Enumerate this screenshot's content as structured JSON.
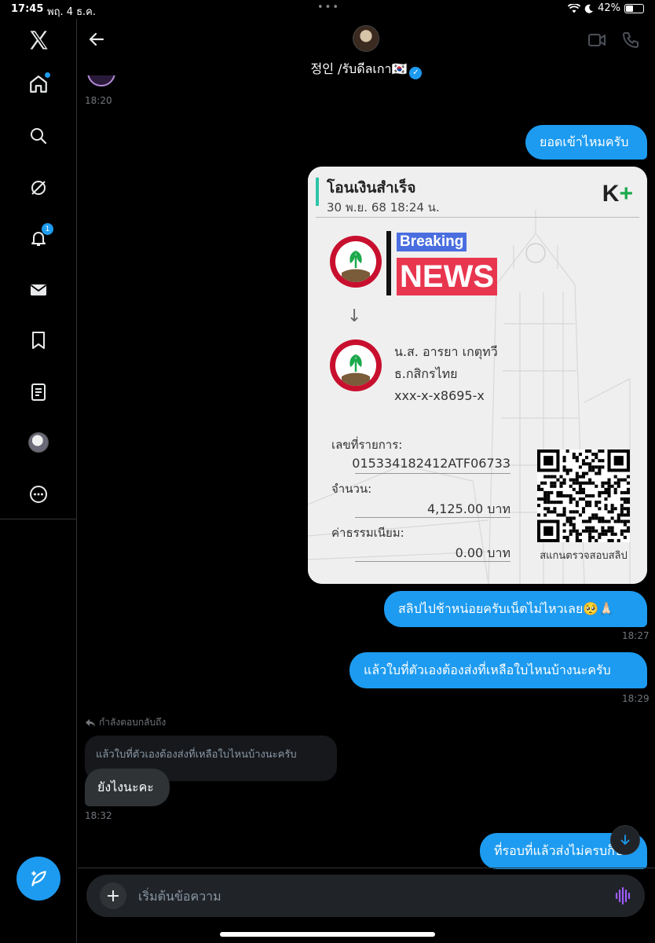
{
  "status_bar": {
    "time": "17:45",
    "date": "พฤ. 4 ธ.ค.",
    "battery": "42%",
    "battery_level": 0.42
  },
  "sidebar": {
    "items": [
      {
        "icon": "x-logo-icon"
      },
      {
        "icon": "home-icon"
      },
      {
        "icon": "search-icon"
      },
      {
        "icon": "grok-icon"
      },
      {
        "icon": "notifications-icon",
        "badge": "1"
      },
      {
        "icon": "messages-icon"
      },
      {
        "icon": "bookmarks-icon"
      },
      {
        "icon": "lists-icon"
      },
      {
        "icon": "profile-avatar"
      },
      {
        "icon": "more-icon"
      }
    ],
    "compose_icon": "compose-post-icon"
  },
  "header": {
    "name": "정인 /รับดีลเกา🇰🇷",
    "verified": true
  },
  "messages": {
    "ts_1": "18:20",
    "out_1": "ยอดเข้าไหมครับ",
    "slip": {
      "title": "โอนเงินสำเร็จ",
      "date": "30 พ.ย. 68  18:24 น.",
      "brand_k": "K",
      "brand_plus": "+",
      "sticker_breaking": "Breaking",
      "sticker_news": "NEWS",
      "recipient_name": "น.ส. อารยา เกตุทวี",
      "recipient_bank": "ธ.กสิกรไทย",
      "recipient_account": "xxx-x-x8695-x",
      "ref_label": "เลขที่รายการ:",
      "ref_value": "015334182412ATF06733",
      "amount_label": "จำนวน:",
      "amount_value": "4,125.00 บาท",
      "fee_label": "ค่าธรรมเนียม:",
      "fee_value": "0.00 บาท",
      "qr_caption": "สแกนตรวจสอบสลิป"
    },
    "out_2": "สลิปไปช้าหน่อยครับเน็ตไม่ไหวเลย🥺🙏🏻",
    "ts_2": "18:27",
    "out_3": "แล้วใบที่ตัวเองต้องส่งที่เหลือใบไหนบ้างนะครับ",
    "ts_3": "18:29",
    "reply_label": "กำลังตอบกลับถึง",
    "quoted": "แล้วใบที่ตัวเองต้องส่งที่เหลือใบไหนบ้างนะครับ",
    "in_1": "ยังไงนะคะ",
    "ts_4": "18:32",
    "out_4": "ที่รอบที่แล้วส่งไม่ครบก็ป"
  },
  "composer": {
    "placeholder": "เริ่มต้นข้อความ"
  },
  "colors": {
    "accent": "#1d9bf0",
    "background": "#000000",
    "incoming_bubble": "#2f3336"
  }
}
